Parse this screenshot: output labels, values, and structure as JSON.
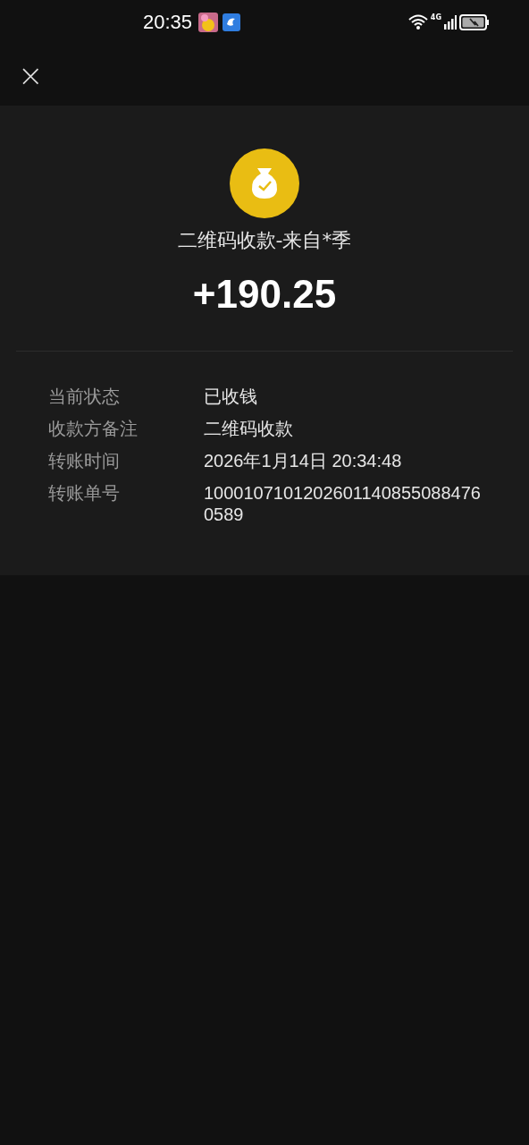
{
  "status_bar": {
    "time": "20:35",
    "network": "4G"
  },
  "header": {
    "close": "×"
  },
  "transaction": {
    "title": "二维码收款-来自*季",
    "amount": "+190.25"
  },
  "details": [
    {
      "label": "当前状态",
      "value": "已收钱"
    },
    {
      "label": "收款方备注",
      "value": "二维码收款"
    },
    {
      "label": "转账时间",
      "value": "2026年1月14日 20:34:48"
    },
    {
      "label": "转账单号",
      "value": "10001071012026011408550884760589"
    }
  ]
}
